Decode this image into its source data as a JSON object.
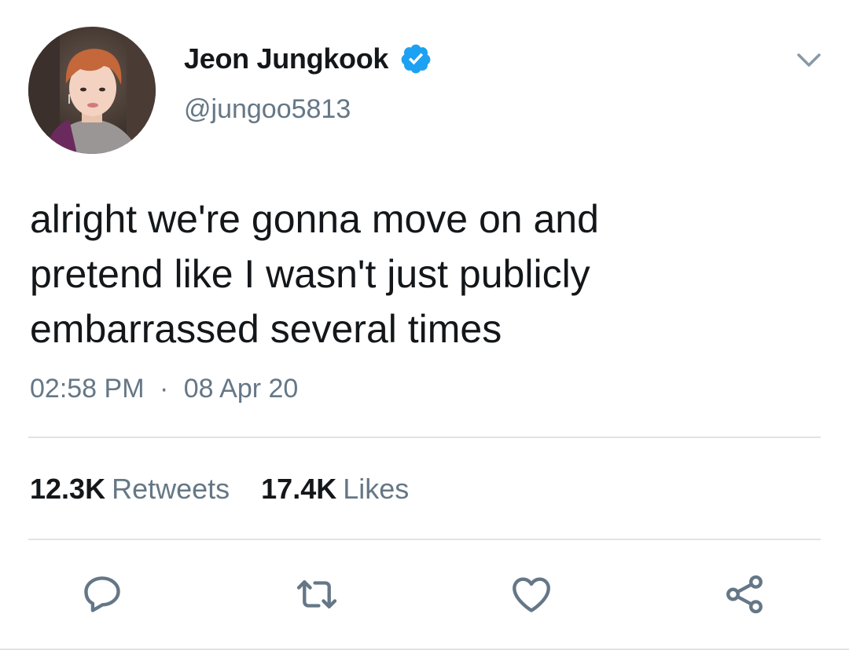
{
  "user": {
    "display_name": "Jeon Jungkook",
    "handle": "@jungoo5813",
    "verified": true,
    "avatar_icon": "profile-photo"
  },
  "tweet": {
    "text": "alright we're gonna move on and\npretend like I wasn't just publicly\nembarrassed several times",
    "time": "02:58 PM",
    "separator": "·",
    "date": "08 Apr 20"
  },
  "stats": {
    "retweets_count": "12.3K",
    "retweets_label": "Retweets",
    "likes_count": "17.4K",
    "likes_label": "Likes"
  },
  "actions": {
    "icons": [
      "reply-icon",
      "retweet-icon",
      "like-icon",
      "share-icon"
    ]
  },
  "colors": {
    "text": "#14171a",
    "secondary": "#657786",
    "verified": "#1da1f2",
    "divider": "#dfe3e6"
  }
}
